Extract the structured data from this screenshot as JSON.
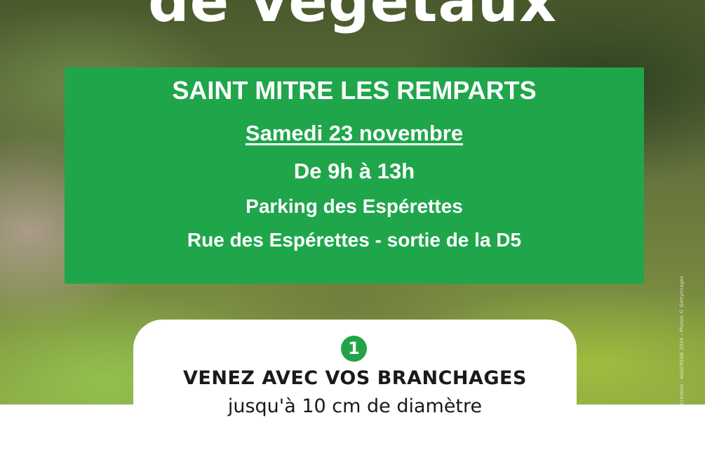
{
  "poster": {
    "headline": "de végétaux",
    "event": {
      "town": "SAINT MITRE LES REMPARTS",
      "date": "Samedi 23 novembre",
      "hours": "De 9h à 13h",
      "place": "Parking des Espérettes",
      "street": "Rue des Espérettes - sortie de la D5"
    },
    "step": {
      "number": "1",
      "title": "VENEZ AVEC VOS BRANCHAGES",
      "subtitle": "jusqu'à 10 cm de diamètre"
    },
    "credit": "Création : AGACREGE 2024 – Photos © GettyImages"
  },
  "colors": {
    "accent_green": "#1fa64b",
    "card": "#ffffff",
    "text": "#ffffff"
  }
}
